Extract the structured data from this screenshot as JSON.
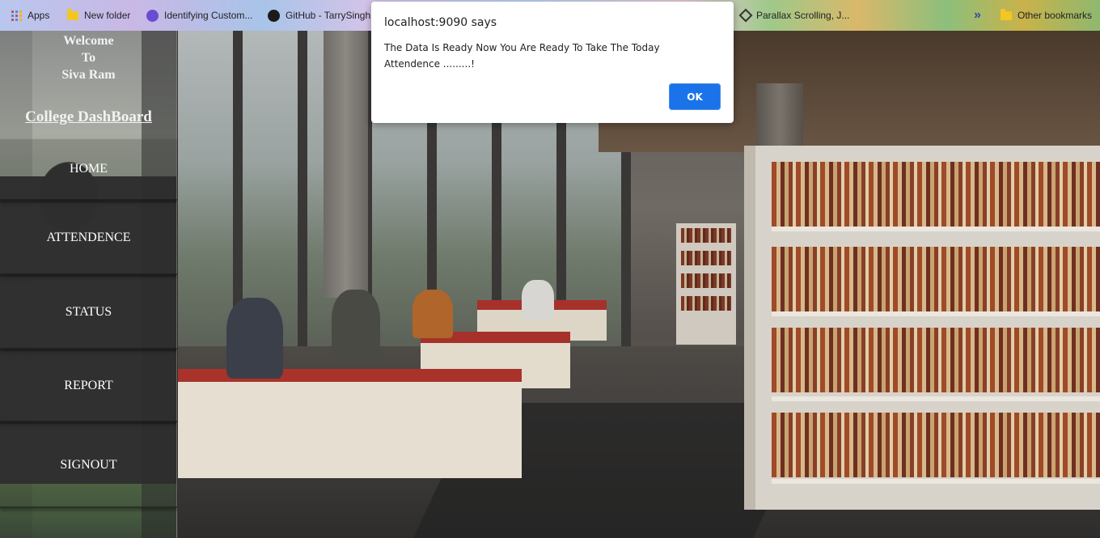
{
  "bookmarks_bar": {
    "items": [
      {
        "label": "Apps",
        "icon": "apps-grid-icon"
      },
      {
        "label": "New folder",
        "icon": "folder-icon"
      },
      {
        "label": "Identifying Custom...",
        "icon": "site-icon"
      },
      {
        "label": "GitHub - TarrySingh",
        "icon": "github-icon"
      },
      {
        "label": "Parallax Scrolling, J...",
        "icon": "codepen-icon"
      }
    ],
    "overflow": "»",
    "other_bookmarks": "Other bookmarks"
  },
  "sidebar": {
    "welcome_line1": "Welcome",
    "welcome_line2": "To",
    "user_name": "Siva Ram",
    "dashboard_title": "College DashBoard",
    "nav": [
      {
        "label": "HOME"
      },
      {
        "label": "ATTENDENCE"
      },
      {
        "label": "STATUS"
      },
      {
        "label": "REPORT"
      },
      {
        "label": "SIGNOUT"
      }
    ]
  },
  "dialog": {
    "title": "localhost:9090 says",
    "message": "The Data Is Ready Now You Are Ready To Take The Today Attendence .........!",
    "ok_label": "OK",
    "ok_color": "#1a73e8"
  }
}
